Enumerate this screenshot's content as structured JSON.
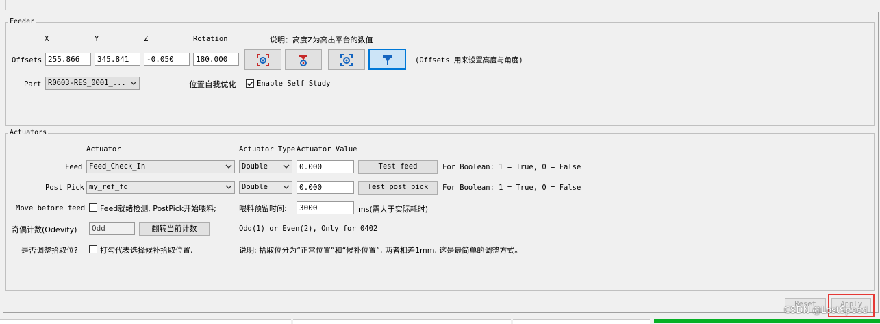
{
  "feeder": {
    "legend": "Feeder",
    "col_x": "X",
    "col_y": "Y",
    "col_z": "Z",
    "col_rotation": "Rotation",
    "note": "说明：高度Z为高出平台的数值",
    "offsets_label": "Offsets",
    "offset_x": "255.866",
    "offset_y": "345.841",
    "offset_z": "-0.050",
    "offset_rotation": "180.000",
    "offsets_hint": "(Offsets 用来设置高度与角度)",
    "part_label": "Part",
    "part_value": "R0603-RES_0001_...",
    "self_opt_label": "位置自我优化",
    "self_study_label": "Enable Self Study",
    "self_study_checked": true,
    "icons": [
      "capture-camera-icon",
      "position-nozzle-icon",
      "position-camera-icon",
      "move-nozzle-icon"
    ]
  },
  "actuators": {
    "legend": "Actuators",
    "col_actuator": "Actuator",
    "col_type": "Actuator Type",
    "col_value": "Actuator Value",
    "feed": {
      "label": "Feed",
      "actuator": "Feed_Check_In",
      "type": "Double",
      "value": "0.000",
      "button": "Test feed",
      "hint": "For Boolean: 1 = True, 0 = False"
    },
    "post_pick": {
      "label": "Post Pick",
      "actuator": "my_ref_fd",
      "type": "Double",
      "value": "0.000",
      "button": "Test post pick",
      "hint": "For Boolean: 1 = True, 0 = False"
    },
    "move_before_feed": {
      "label": "Move before feed",
      "checkbox_label": "Feed就绪检测, PostPick开始喂料;",
      "checked": false,
      "dwell_label": "喂料预留时间:",
      "dwell_value": "3000",
      "dwell_unit": "ms(需大于实际耗时)"
    },
    "odd_even": {
      "label": "奇偶计数(Odevity)",
      "value": "Odd",
      "button": "翻转当前计数",
      "hint": "Odd(1) or Even(2), Only for 0402"
    },
    "adjust_pick": {
      "label": "是否调整拾取位?",
      "checkbox_label": "打勾代表选择候补拾取位置,",
      "checked": false,
      "note": "说明: 拾取位分为“正常位置”和“候补位置”, 两者相差1mm, 这是最简单的调整方式。"
    }
  },
  "footer": {
    "reset": "Reset",
    "apply": "Apply",
    "watermark": "CSDN @LostSpeed"
  },
  "colors": {
    "accent": "#0078d7",
    "highlight": "#e53935",
    "icon_red": "#c62828",
    "icon_blue": "#1565c0"
  }
}
